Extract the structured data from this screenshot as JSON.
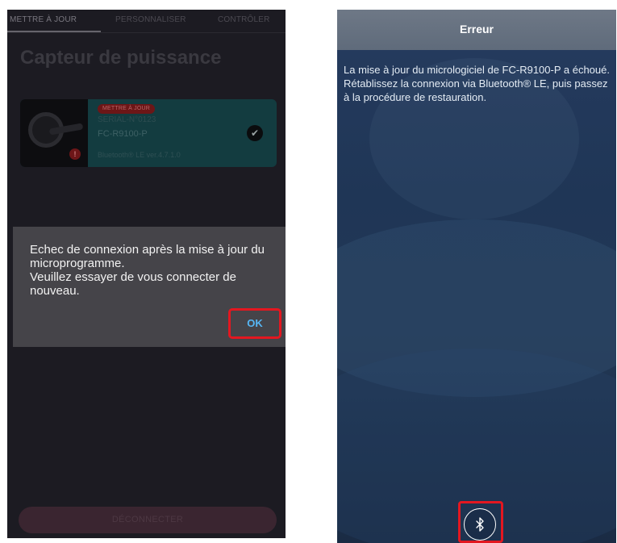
{
  "left_screen": {
    "tabs": [
      {
        "label": "METTRE À JOUR",
        "active": true
      },
      {
        "label": "PERSONNALISER",
        "active": false
      },
      {
        "label": "CONTRÔLER",
        "active": false
      }
    ],
    "title": "Capteur de puissance",
    "device": {
      "badge": "METTRE À JOUR",
      "serial": "SERIAL-N°0123",
      "model": "FC-R9100-P",
      "ble_version": "Bluetooth® LE ver.4.7.1.0",
      "warning_icon": "exclamation-icon",
      "selected_icon": "checkmark-icon"
    },
    "dialog": {
      "message": "Echec de connexion après la mise à jour du microprogramme.\nVeuillez essayer de vous connecter de nouveau.",
      "ok_label": "OK"
    },
    "disconnect_label": "DÉCONNECTER"
  },
  "right_screen": {
    "header_title": "Erreur",
    "message": "La mise à jour du micrologiciel de FC-R9100-P a échoué.\nRétablissez la connexion via Bluetooth® LE, puis passez à la procédure de restauration.",
    "bluetooth_button_icon": "bluetooth-icon"
  },
  "colors": {
    "highlight_red": "#e31720",
    "ok_blue": "#56b7f5",
    "card_teal": "#133c40",
    "error_header": "#6e7886"
  }
}
